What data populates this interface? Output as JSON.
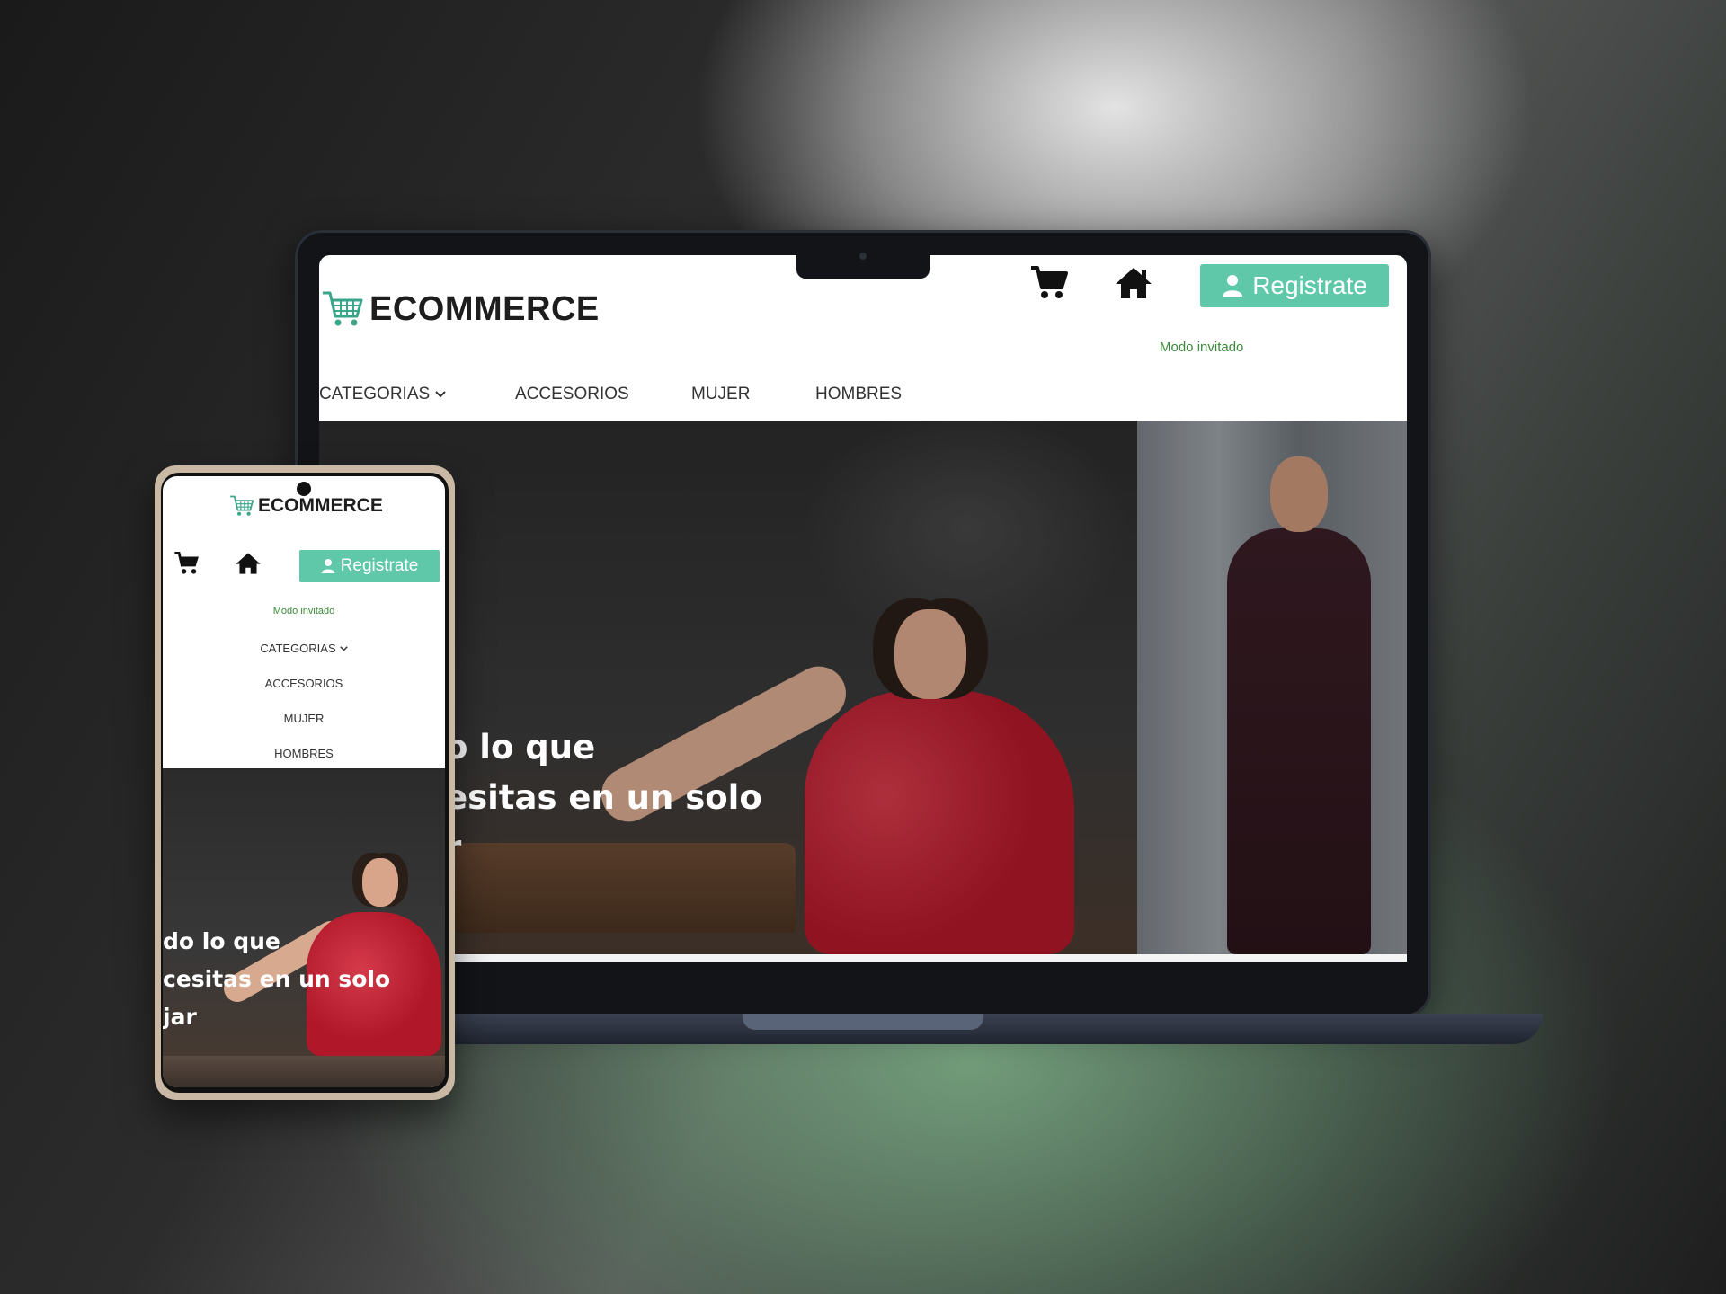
{
  "brand": {
    "name": "ECOMMERCE",
    "accent_color": "#5fc8a8",
    "logo_icon": "shopping-cart-icon"
  },
  "header": {
    "cart_icon": "cart-icon",
    "home_icon": "home-icon",
    "register_label": "Registrate",
    "register_icon": "user-icon",
    "guest_mode": "Modo invitado"
  },
  "nav": {
    "items": [
      {
        "label": "CATEGORIAS",
        "dropdown": true
      },
      {
        "label": "ACCESORIOS"
      },
      {
        "label": "MUJER"
      },
      {
        "label": "HOMBRES"
      }
    ]
  },
  "hero": {
    "laptop_lines": [
      "o lo que",
      "esitas en un solo",
      "r"
    ],
    "phone_lines": [
      "do lo que",
      "cesitas en un solo",
      "jar"
    ]
  }
}
